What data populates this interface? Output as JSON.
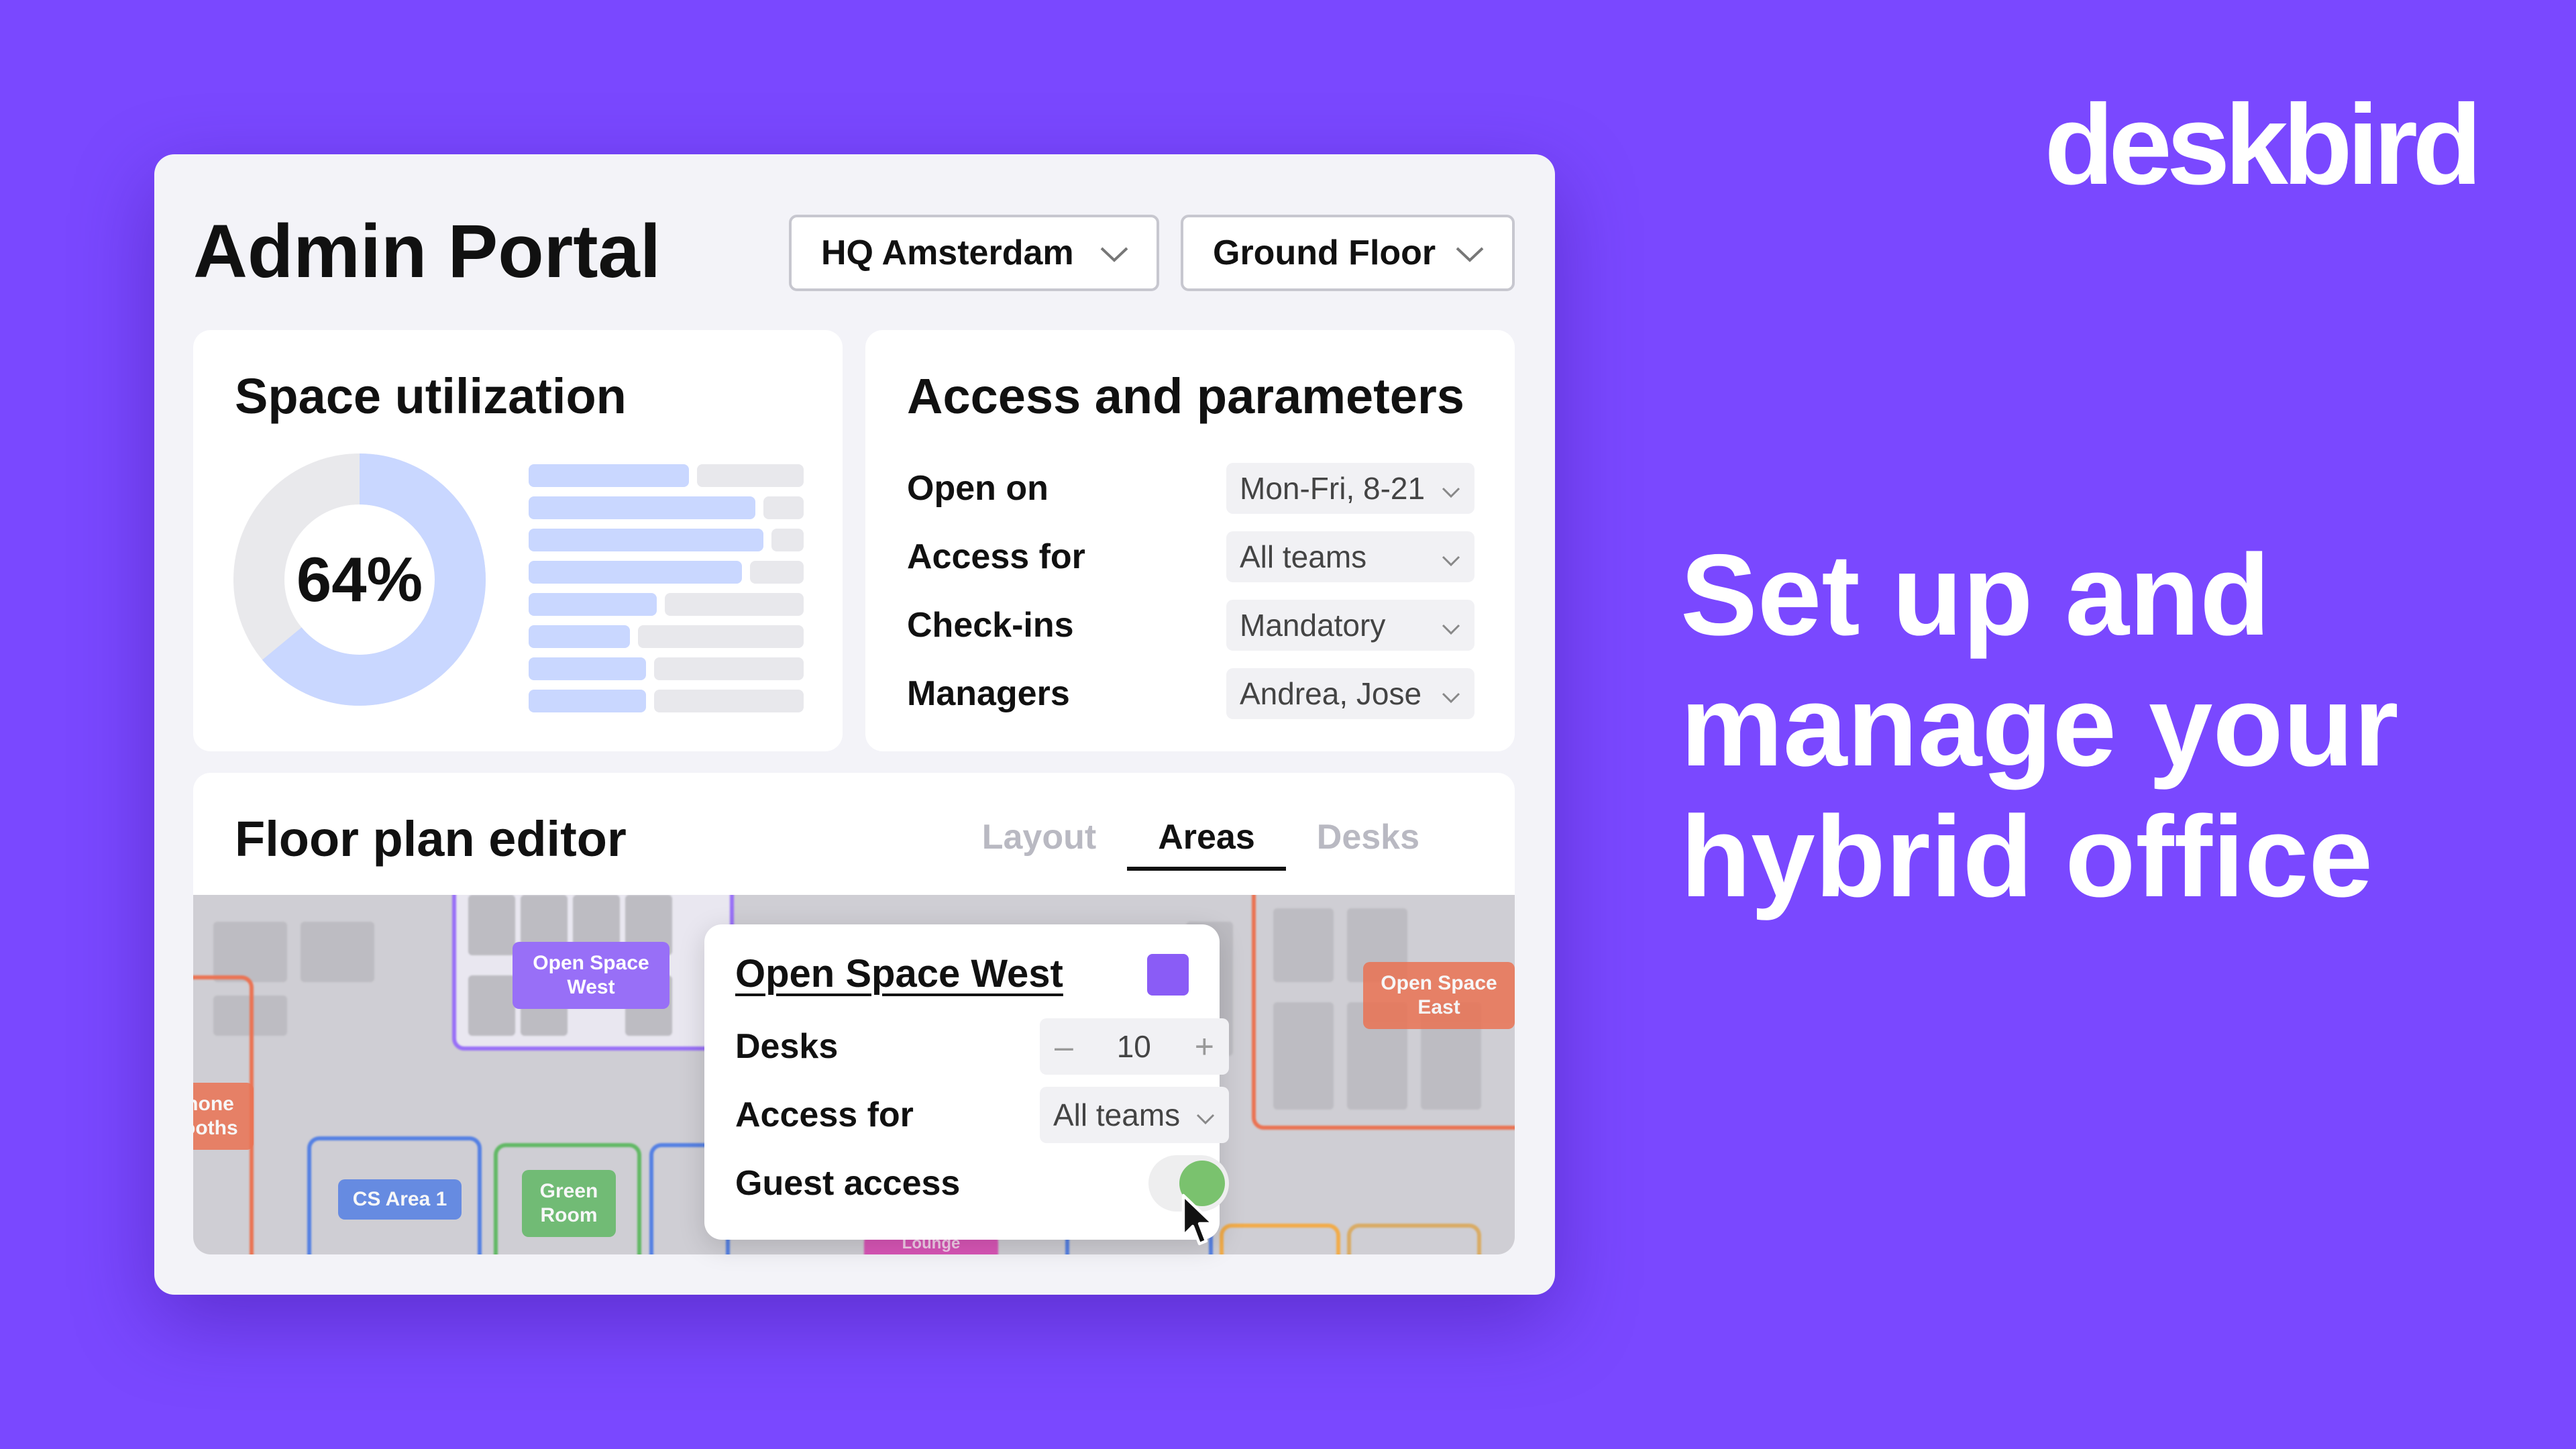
{
  "brand": {
    "logo_text": "deskbird",
    "background": "#7a48ff"
  },
  "headline": [
    "Set up and",
    "manage your",
    "hybrid office"
  ],
  "portal": {
    "title": "Admin Portal",
    "site_select": {
      "value": "HQ Amsterdam"
    },
    "floor_select": {
      "value": "Ground Floor"
    }
  },
  "utilization": {
    "title": "Space utilization",
    "percent_label": "64%",
    "percent": 64,
    "accent": "#c9d7ff",
    "bar_fractions": [
      0.6,
      0.85,
      0.88,
      0.8,
      0.48,
      0.38,
      0.44,
      0.44
    ]
  },
  "access": {
    "title": "Access and parameters",
    "rows": [
      {
        "label": "Open on",
        "value": "Mon-Fri, 8-21"
      },
      {
        "label": "Access for",
        "value": "All teams"
      },
      {
        "label": "Check-ins",
        "value": "Mandatory"
      },
      {
        "label": "Managers",
        "value": "Andrea, Jose"
      }
    ]
  },
  "floor_editor": {
    "title": "Floor plan editor",
    "tabs": [
      "Layout",
      "Areas",
      "Desks"
    ],
    "active_tab": "Areas",
    "map_tags": {
      "open_space_west": "Open Space West",
      "open_space_east": "Open Space East",
      "phone_booths": "Phone Booths",
      "cs_area_1": "CS Area 1",
      "green_room": "Green Room",
      "lounge": "Lounge"
    },
    "colors": {
      "west": "#8a5cf6",
      "east": "#e8603c",
      "cs": "#3d6fe0",
      "green": "#4caf50",
      "lounge": "#d43fae"
    }
  },
  "area_popup": {
    "title": "Open Space West",
    "swatch_color": "#8a5cf6",
    "desks_label": "Desks",
    "desks_value": "10",
    "minus": "–",
    "plus": "+",
    "access_label": "Access for",
    "access_value": "All teams",
    "guest_label": "Guest access",
    "guest_enabled": true
  }
}
